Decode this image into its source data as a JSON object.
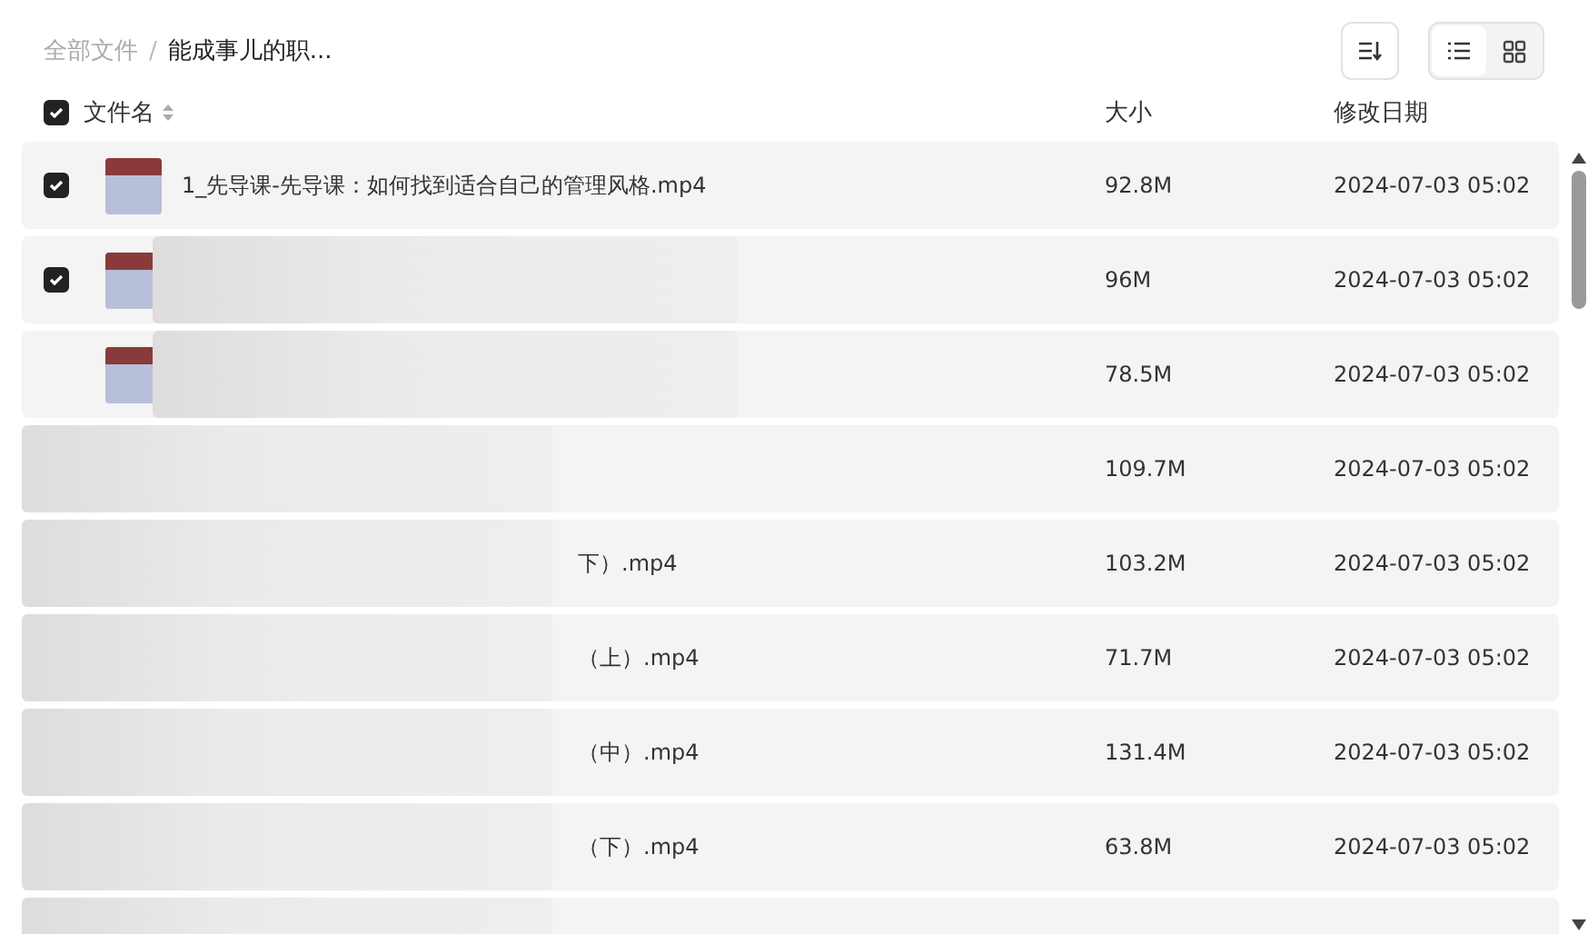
{
  "breadcrumb": [
    {
      "label": "全部文件",
      "current": false
    },
    {
      "label": "能成事儿的职...",
      "current": true
    }
  ],
  "breadcrumb_separator": "/",
  "view_modes": [
    {
      "kind": "list",
      "selected": true
    },
    {
      "kind": "grid",
      "selected": false
    }
  ],
  "table": {
    "select_all": {
      "checked": true
    },
    "columns": [
      {
        "label": "文件名",
        "sortable": true
      },
      {
        "label": "大小",
        "sortable": false
      },
      {
        "label": "修改日期",
        "sortable": false
      }
    ],
    "rows": [
      {
        "kind": "plain",
        "checked": true,
        "thumbnail": true,
        "name": "1_先导课-先导课：如何找到适合自己的管理风格.mp4",
        "size": "92.8M",
        "date": "2024-07-03 05:02"
      },
      {
        "kind": "blurred",
        "checked": true,
        "thumbnail": true,
        "size": "96M",
        "date": "2024-07-03 05:02"
      },
      {
        "kind": "blurred",
        "thumbnail": true,
        "size": "78.5M",
        "date": "2024-07-03 05:02"
      },
      {
        "kind": "covered",
        "size": "109.7M",
        "date": "2024-07-03 05:02"
      },
      {
        "kind": "covered",
        "name": "下）.mp4",
        "size": "103.2M",
        "date": "2024-07-03 05:02"
      },
      {
        "kind": "covered",
        "name": "（上）.mp4",
        "size": "71.7M",
        "date": "2024-07-03 05:02"
      },
      {
        "kind": "covered",
        "name": "（中）.mp4",
        "size": "131.4M",
        "date": "2024-07-03 05:02"
      },
      {
        "kind": "covered",
        "name": "（下）.mp4",
        "size": "63.8M",
        "date": "2024-07-03 05:02"
      },
      {
        "kind": "covered"
      }
    ]
  }
}
